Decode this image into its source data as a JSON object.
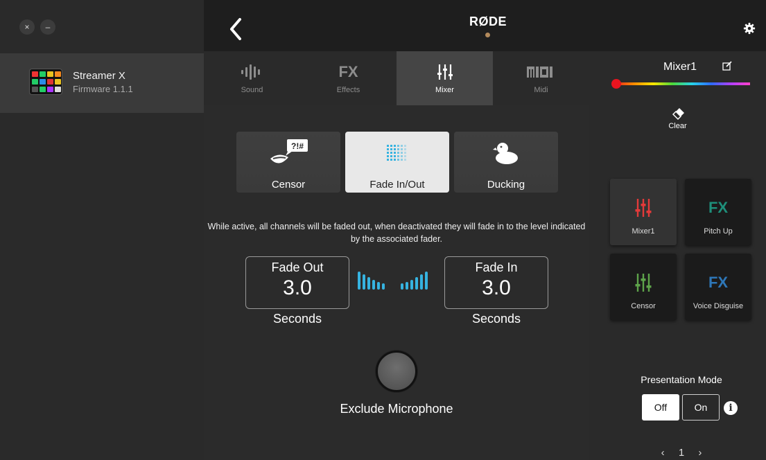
{
  "window": {
    "close_glyph": "×",
    "minimize_glyph": "–"
  },
  "sidebar": {
    "device_name": "Streamer X",
    "firmware": "Firmware 1.1.1"
  },
  "header": {
    "brand": "RØDE",
    "accent": "#b38a5c"
  },
  "tabs": [
    {
      "label": "Sound",
      "icon": "waveform-icon",
      "active": false
    },
    {
      "label": "Effects",
      "icon": "fx-icon",
      "icon_text": "FX",
      "active": false
    },
    {
      "label": "Mixer",
      "icon": "mixer-sliders-icon",
      "active": true
    },
    {
      "label": "Midi",
      "icon": "midi-icon",
      "icon_text": "MIDI",
      "active": false
    }
  ],
  "modes": [
    {
      "label": "Censor",
      "icon": "censor-icon",
      "icon_text": "?!#",
      "active": false
    },
    {
      "label": "Fade In/Out",
      "icon": "fade-grid-icon",
      "active": true
    },
    {
      "label": "Ducking",
      "icon": "duck-icon",
      "active": false
    }
  ],
  "description": "While active, all channels will be faded out, when deactivated they will fade in to the level indicated by the associated fader.",
  "fade_out": {
    "title": "Fade Out",
    "value": "3.0",
    "unit": "Seconds"
  },
  "fade_in": {
    "title": "Fade In",
    "value": "3.0",
    "unit": "Seconds"
  },
  "exclude_label": "Exclude Microphone",
  "right_panel": {
    "title": "Mixer1",
    "clear_label": "Clear",
    "selected_color": "#e8141f",
    "pads": [
      {
        "label": "Mixer1",
        "icon": "mixer-sliders-icon",
        "color": "#e43a3a",
        "active": true
      },
      {
        "label": "Pitch Up",
        "icon": "fx-icon",
        "icon_text": "FX",
        "color": "#1e8f7a",
        "active": false
      },
      {
        "label": "Censor",
        "icon": "mixer-sliders-icon",
        "color": "#5da34a",
        "active": false
      },
      {
        "label": "Voice Disguise",
        "icon": "fx-icon",
        "icon_text": "FX",
        "color": "#2e77b8",
        "active": false
      }
    ],
    "presentation_mode": {
      "title": "Presentation Mode",
      "off_label": "Off",
      "on_label": "On",
      "selected": "Off",
      "info_glyph": "i"
    },
    "pager": {
      "prev": "‹",
      "page": "1",
      "next": "›"
    }
  }
}
